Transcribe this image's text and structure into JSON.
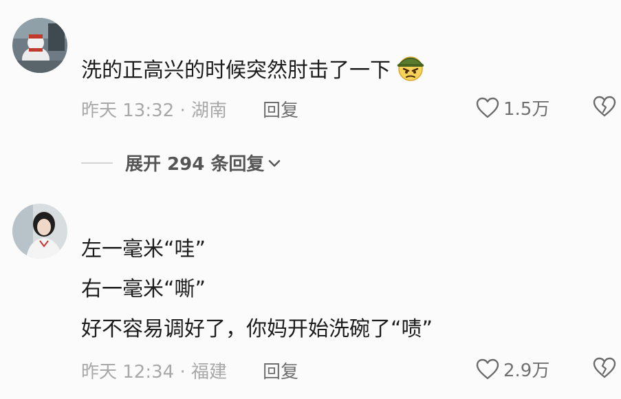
{
  "comments": [
    {
      "username": "",
      "lines": [
        "洗的正高兴的时候突然肘击了一下"
      ],
      "emoji_icon": "angry-soldier-emoji-icon",
      "time_location": "昨天 13:32 · 湖南",
      "reply_label": "回复",
      "likes": "1.5万",
      "expand_label": "展开 294 条回复"
    },
    {
      "username": "",
      "lines": [
        "左一毫米“哇”",
        "右一毫米“嘶”",
        "好不容易调好了，你妈开始洗碗了“啧”"
      ],
      "time_location": "昨天 12:34 · 福建",
      "reply_label": "回复",
      "likes": "2.9万"
    }
  ],
  "colors": {
    "text": "#1b1b1b",
    "meta": "#a8a8a8",
    "action": "#6f6f6f",
    "background": "#fbfbfb"
  }
}
